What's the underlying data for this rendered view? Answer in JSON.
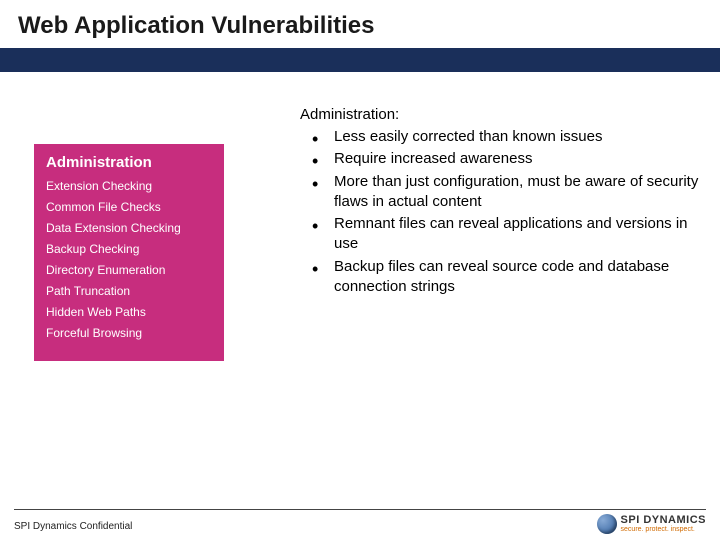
{
  "title": "Web Application Vulnerabilities",
  "sidebar": {
    "heading": "Administration",
    "items": [
      "Extension Checking",
      "Common File Checks",
      "Data Extension Checking",
      "Backup Checking",
      "Directory Enumeration",
      "Path Truncation",
      "Hidden Web Paths",
      "Forceful Browsing"
    ]
  },
  "main": {
    "heading": "Administration:",
    "bullets": [
      "Less easily corrected than known issues",
      "Require increased awareness",
      "More than just configuration, must be aware of security flaws in actual content",
      "Remnant files can reveal applications and versions in use",
      "Backup files can reveal source code and database connection strings"
    ]
  },
  "footer": {
    "confidential": "SPI Dynamics Confidential",
    "logo_main": "SPI DYNAMICS",
    "logo_tag": "secure. protect. inspect."
  }
}
